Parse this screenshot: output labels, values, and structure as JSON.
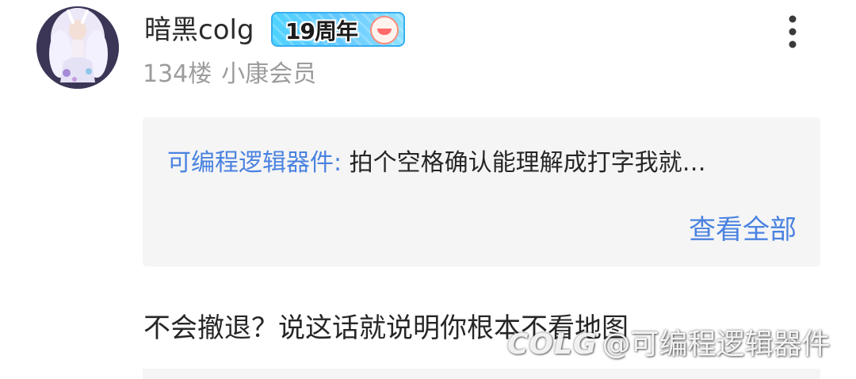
{
  "post": {
    "username": "暗黑colg",
    "anniversary_badge": "19周年",
    "floor": "134楼",
    "member_level": "小康会员",
    "quote": {
      "author": "可编程逻辑器件:",
      "text": "拍个空格确认能理解成打字我就…",
      "view_all": "查看全部"
    },
    "content": "不会撤退？说这话就说明你根本不看地图"
  },
  "watermark": {
    "logo": "COLG",
    "text": "@可编程逻辑器件"
  },
  "icons": {
    "more": "more-vertical-icon"
  },
  "colors": {
    "link_blue": "#4a82e0",
    "meta_gray": "#9c9c9c",
    "quote_bg": "#f5f5f5"
  }
}
